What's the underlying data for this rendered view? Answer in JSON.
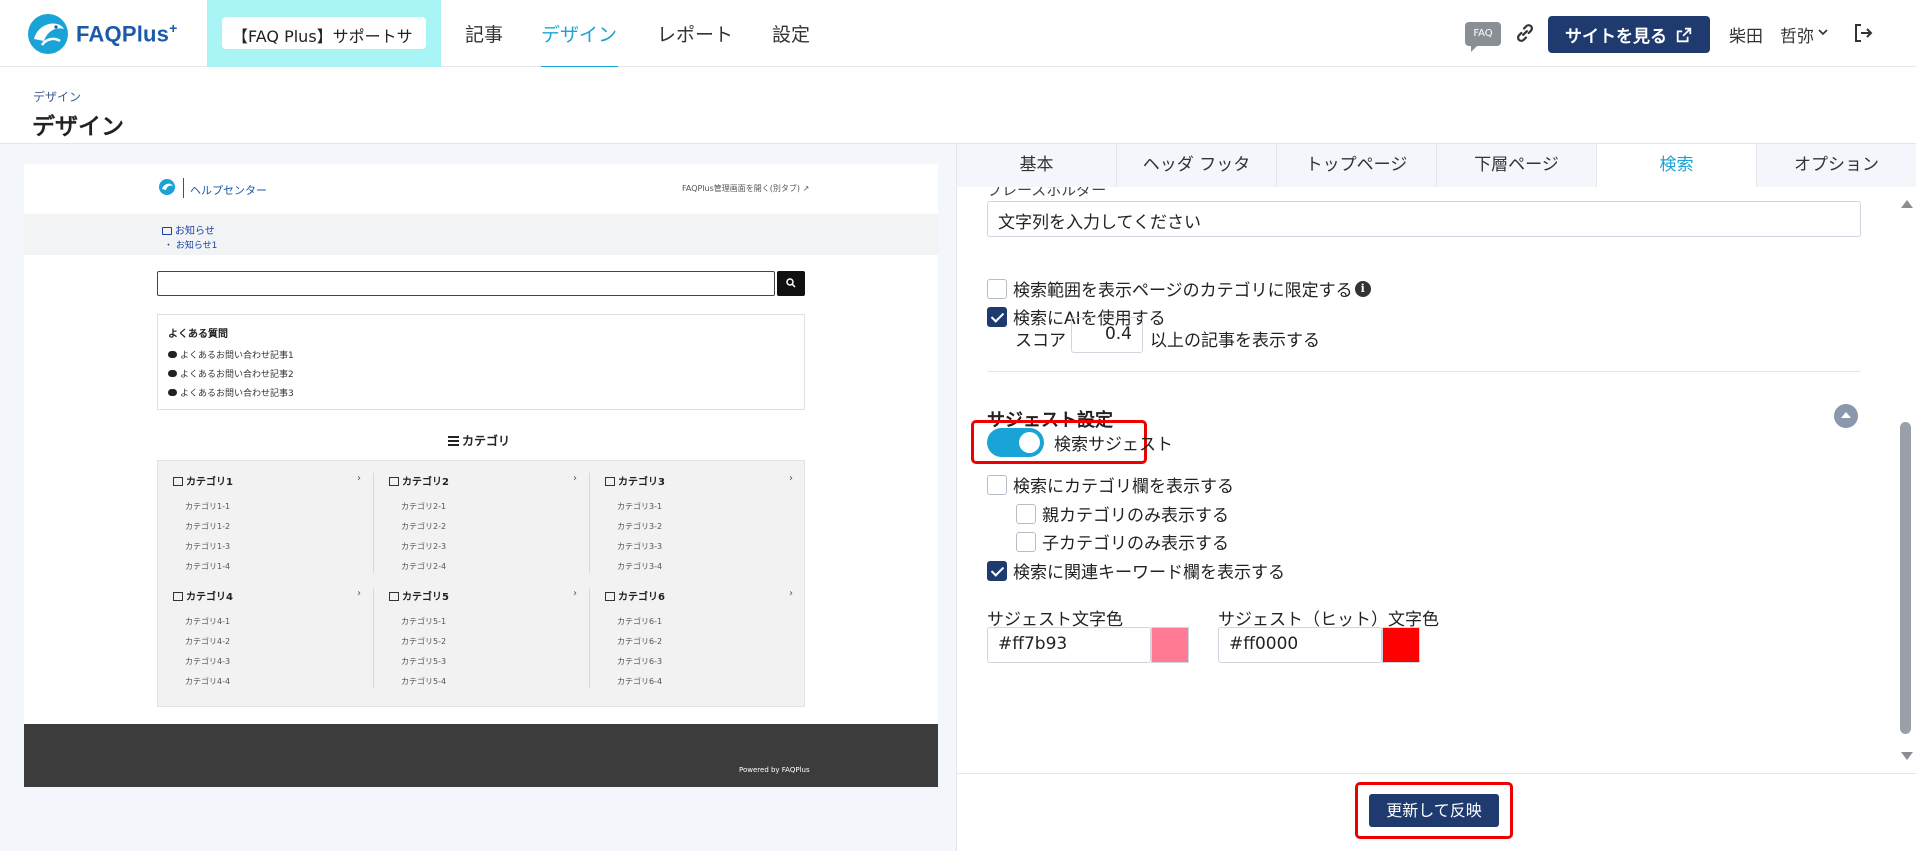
{
  "app": {
    "logo_text": "FAQPlus",
    "logo_sup": "+",
    "site_selector": "【FAQ Plus】サポートサ"
  },
  "nav": {
    "items": [
      "記事",
      "デザイン",
      "レポート",
      "設定"
    ],
    "active": "デザイン"
  },
  "header_right": {
    "faq_badge": "FAQ",
    "view_site_label": "サイトを見る",
    "user_name": "柴田　哲弥"
  },
  "page": {
    "breadcrumb": "デザイン",
    "title": "デザイン"
  },
  "preview": {
    "help_center": "ヘルプセンター",
    "top_link": "FAQPlus管理画面を開く(別タブ)",
    "news_title": "お知らせ",
    "news_item": "・ お知らせ1",
    "faq_title": "よくある質問",
    "faq_items": [
      "よくあるお問い合わせ記事1",
      "よくあるお問い合わせ記事2",
      "よくあるお問い合わせ記事3"
    ],
    "category_heading": "カテゴリ",
    "categories": [
      {
        "name": "カテゴリ1",
        "subs": [
          "カテゴリ1-1",
          "カテゴリ1-2",
          "カテゴリ1-3",
          "カテゴリ1-4"
        ]
      },
      {
        "name": "カテゴリ2",
        "subs": [
          "カテゴリ2-1",
          "カテゴリ2-2",
          "カテゴリ2-3",
          "カテゴリ2-4"
        ]
      },
      {
        "name": "カテゴリ3",
        "subs": [
          "カテゴリ3-1",
          "カテゴリ3-2",
          "カテゴリ3-3",
          "カテゴリ3-4"
        ]
      },
      {
        "name": "カテゴリ4",
        "subs": [
          "カテゴリ4-1",
          "カテゴリ4-2",
          "カテゴリ4-3",
          "カテゴリ4-4"
        ]
      },
      {
        "name": "カテゴリ5",
        "subs": [
          "カテゴリ5-1",
          "カテゴリ5-2",
          "カテゴリ5-3",
          "カテゴリ5-4"
        ]
      },
      {
        "name": "カテゴリ6",
        "subs": [
          "カテゴリ6-1",
          "カテゴリ6-2",
          "カテゴリ6-3",
          "カテゴリ6-4"
        ]
      }
    ],
    "chevron": "›",
    "powered_by": "Powered by FAQPlus"
  },
  "tabs": {
    "items": [
      "基本",
      "ヘッダ フッタ",
      "トップページ",
      "下層ページ",
      "検索",
      "オプション"
    ],
    "active": "検索"
  },
  "search_settings": {
    "clipped_label": "プレースホルダー",
    "placeholder_value": "文字列を入力してください",
    "limit_to_category_label": "検索範囲を表示ページのカテゴリに限定する",
    "limit_to_category_checked": false,
    "info_icon": "i",
    "use_ai_label": "検索にAIを使用する",
    "use_ai_checked": true,
    "score_label": "スコア",
    "score_value": "0.4",
    "score_suffix": "以上の記事を表示する"
  },
  "suggest_settings": {
    "title": "サジェスト設定",
    "toggle_label": "検索サジェスト",
    "toggle_on": true,
    "show_category_label": "検索にカテゴリ欄を表示する",
    "show_category_checked": false,
    "parent_only_label": "親カテゴリのみ表示する",
    "parent_only_checked": false,
    "child_only_label": "子カテゴリのみ表示する",
    "child_only_checked": false,
    "show_keyword_label": "検索に関連キーワード欄を表示する",
    "show_keyword_checked": true,
    "text_color_label": "サジェスト文字色",
    "text_color_value": "#ff7b93",
    "hit_color_label": "サジェスト（ヒット）文字色",
    "hit_color_value": "#ff0000"
  },
  "actions": {
    "update_label": "更新して反映"
  },
  "colors": {
    "accent": "#1aa3d6",
    "primary": "#1e3a6e",
    "highlight": "#ee0000"
  }
}
